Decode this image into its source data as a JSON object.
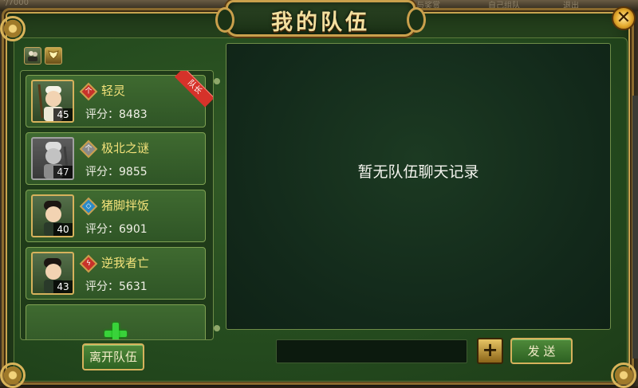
{
  "background": {
    "top_text_left": "ʻ/7000",
    "top_text_right_1": "复与奖赏",
    "top_text_right_2": "自己组队",
    "top_text_right_3": "退出"
  },
  "dialog": {
    "title": "我的队伍",
    "close_label": "✕"
  },
  "tabs": [
    {
      "icon": "team-members-icon"
    },
    {
      "icon": "wings-icon"
    }
  ],
  "leader_tag": "队长",
  "members": [
    {
      "name": "轻灵",
      "score": "评分：8483",
      "level": "45",
      "class_glyph": "个",
      "class_color": "#c8322a",
      "offline": false,
      "leader": true
    },
    {
      "name": "极北之谜",
      "score": "评分：9855",
      "level": "47",
      "class_glyph": "个",
      "class_color": "#8a8a8a",
      "offline": true,
      "leader": false
    },
    {
      "name": "猪脚拌饭",
      "score": "评分：6901",
      "level": "40",
      "class_glyph": "◇",
      "class_color": "#2a8ac8",
      "offline": false,
      "leader": false
    },
    {
      "name": "逆我者亡",
      "score": "评分：5631",
      "level": "43",
      "class_glyph": "ϟ",
      "class_color": "#c8322a",
      "offline": false,
      "leader": false
    }
  ],
  "chat": {
    "empty_text": "暂无队伍聊天记录",
    "input_value": "",
    "emoji_label": "+",
    "send_label": "发 送"
  },
  "leave_label": "离开队伍",
  "colors": {
    "accent_gold": "#d6b25c",
    "panel_green": "#2f5526",
    "name_yellow": "#f3e27a",
    "add_green": "#39d23a"
  }
}
